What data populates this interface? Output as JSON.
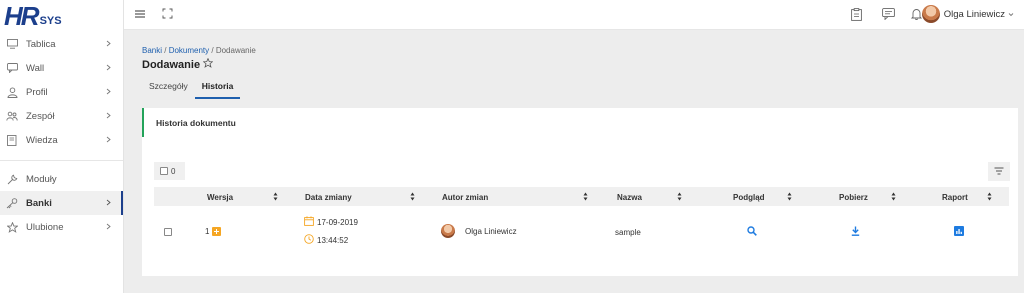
{
  "brand": {
    "logo_main": "HR",
    "logo_sub": "SYS"
  },
  "sidebar": {
    "items": [
      {
        "label": "Tablica",
        "icon": "monitor-icon"
      },
      {
        "label": "Wall",
        "icon": "chat-icon"
      },
      {
        "label": "Profil",
        "icon": "user-icon"
      },
      {
        "label": "Zespół",
        "icon": "team-icon"
      },
      {
        "label": "Wiedza",
        "icon": "book-icon"
      },
      {
        "label": "Moduły",
        "icon": "wrench-icon"
      },
      {
        "label": "Banki",
        "icon": "key-icon",
        "active": true
      },
      {
        "label": "Ulubione",
        "icon": "star-icon"
      }
    ]
  },
  "topbar": {
    "user_name": "Olga Liniewicz"
  },
  "breadcrumb": {
    "part1": "Banki",
    "sep1": " / ",
    "part2": "Dokumenty",
    "sep2": " / ",
    "part3": "Dodawanie"
  },
  "page": {
    "title": "Dodawanie"
  },
  "tabs": [
    {
      "label": "Szczegóły"
    },
    {
      "label": "Historia",
      "active": true
    }
  ],
  "card": {
    "title": "Historia dokumentu"
  },
  "selection": {
    "count": "0"
  },
  "table": {
    "columns": [
      "Wersja",
      "Data zmiany",
      "Autor zmian",
      "Nazwa",
      "Podgląd",
      "Pobierz",
      "Raport"
    ],
    "rows": [
      {
        "version": "1",
        "date": "17-09-2019",
        "time": "13:44:52",
        "author": "Olga Liniewicz",
        "name": "sample"
      }
    ]
  },
  "colors": {
    "primary": "#1c3f8c",
    "link": "#1e5fae",
    "accent_green": "#23a35a",
    "accent_orange": "#f5a623",
    "action_blue": "#1e7be0"
  }
}
